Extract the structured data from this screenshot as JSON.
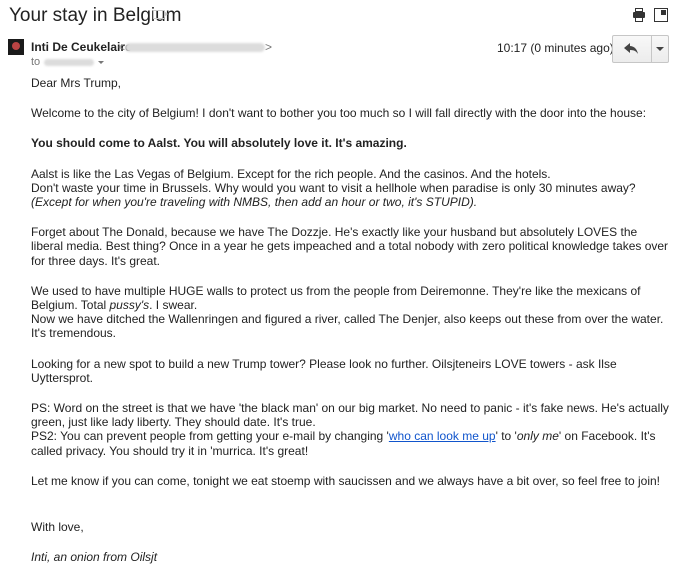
{
  "subject": "Your stay in Belgium",
  "sender": {
    "name": "Inti De Ceukelaire",
    "email_prefix": "<",
    "email_suffix": ">",
    "to_label": "to"
  },
  "time": "10:17 (0 minutes ago)",
  "icons": {
    "label": "label-icon",
    "print": "print-icon",
    "new_window": "new-window-icon",
    "reply": "reply-icon",
    "more": "chevron-down-icon"
  },
  "body": {
    "greeting": "Dear Mrs Trump,",
    "p1": "Welcome to the city of Belgium! I don't want to bother you too much so I will fall directly with the door into the house:",
    "p2": "You should come to Aalst. You will absolutely love it. It's amazing.",
    "p3a": "Aalst is like the Las Vegas of Belgium. Except for the rich people. And the casinos. And the hotels.",
    "p3b": "Don't waste your time in Brussels. Why would you want to visit a hellhole when paradise is only 30 minutes away? ",
    "p3b_italic": "(Except for when you're traveling with NMBS, then add an hour or two, it's STUPID).",
    "p4": "Forget about The Donald, because we have The Dozzje. He's exactly like your husband but absolutely LOVES the liberal media. Best thing? Once in a year he gets impeached and a total nobody with zero political knowledge takes over for three days. It's great.",
    "p5a": "We used to have multiple HUGE walls to protect us from the people from Deiremonne. They're like the mexicans of Belgium. Total ",
    "p5a_italic": "pussy's",
    "p5a_end": ". I swear.",
    "p5b": "Now we have ditched the Wallenringen and figured a river, called The Denjer, also keeps out these from over the water. It's tremendous.",
    "p6": "Looking for a new spot to build a new Trump tower? Please look no further. Oilsjteneirs LOVE towers - ask Ilse Uyttersprot.",
    "ps1": "PS: Word on the street is that we have 'the black man' on our big market. No need to panic - it's fake news. He's actually green, just like lady liberty. They should date. It's true.",
    "ps2_start": "PS2: You can prevent people from getting your e-mail by changing '",
    "ps2_link": "who can look me up",
    "ps2_mid": "' to '",
    "ps2_italic": "only me",
    "ps2_end": "' on Facebook. It's called privacy. You should try it in 'murrica. It's great!",
    "p7": "Let me know if you can come, tonight we eat stoemp with saucissen and we always have a bit over, so feel free to join!",
    "closing": "With love,",
    "signature": "Inti, an onion from Oilsjt"
  },
  "colors": {
    "link": "#1155cc",
    "text": "#222222",
    "muted": "#777777"
  }
}
